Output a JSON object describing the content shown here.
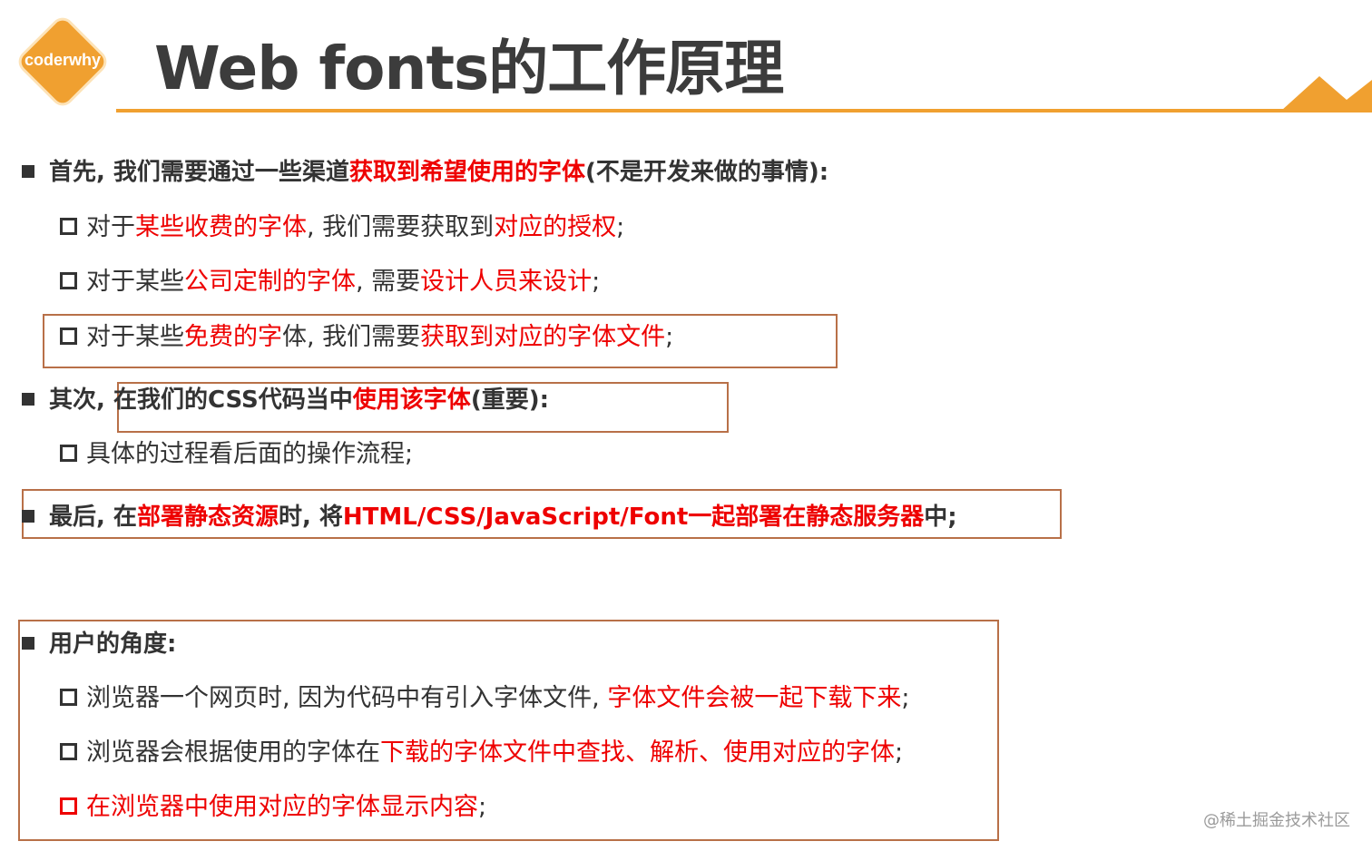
{
  "logo": {
    "text": "coderwhy"
  },
  "title": "Web fonts的工作原理",
  "colors": {
    "accent": "#f0a030",
    "highlight": "#ee0000",
    "box_border": "#b87048",
    "text": "#333333"
  },
  "sections": {
    "first": {
      "a": "首先, 我们需要通过一些渠道",
      "b": "获取到希望使用的字体",
      "c": "(不是开发来做的事情):",
      "items": [
        {
          "a": "对于",
          "b": "某些收费的字体",
          "c": ", 我们需要获取到",
          "d": "对应的授权",
          "e": ";"
        },
        {
          "a": "对于某些",
          "b": "公司定制的字体",
          "c": ", 需要",
          "d": "设计人员来设计",
          "e": ";"
        },
        {
          "a": "对于某些",
          "b": "免费的字",
          "c": "体, 我们需要",
          "d": "获取到对应的字体文件",
          "e": ";"
        }
      ]
    },
    "second": {
      "a": "其次, ",
      "b": "在我们的CSS代码当中",
      "c": "使用该字体",
      "d": "(重要):",
      "items": [
        {
          "a": "具体的过程看后面的操作流程;"
        }
      ]
    },
    "third": {
      "a": "最后, 在",
      "b": "部署静态资源",
      "c": "时, 将",
      "d": "HTML/CSS/JavaScript/Font一起部署在静态服务器",
      "e": "中;"
    },
    "user": {
      "heading": "用户的角度:",
      "items": [
        {
          "a": "浏览器一个网页时, 因为代码中有引入字体文件, ",
          "b": "字体文件会被一起下载下来",
          "c": ";"
        },
        {
          "a": "浏览器会根据使用的字体在",
          "b": "下载的字体文件中查找、解析、使用对应的字体",
          "c": ";"
        },
        {
          "a": "在浏览器中使用对应的字体显示内容",
          "b": ";"
        }
      ]
    }
  },
  "watermark": "@稀土掘金技术社区"
}
